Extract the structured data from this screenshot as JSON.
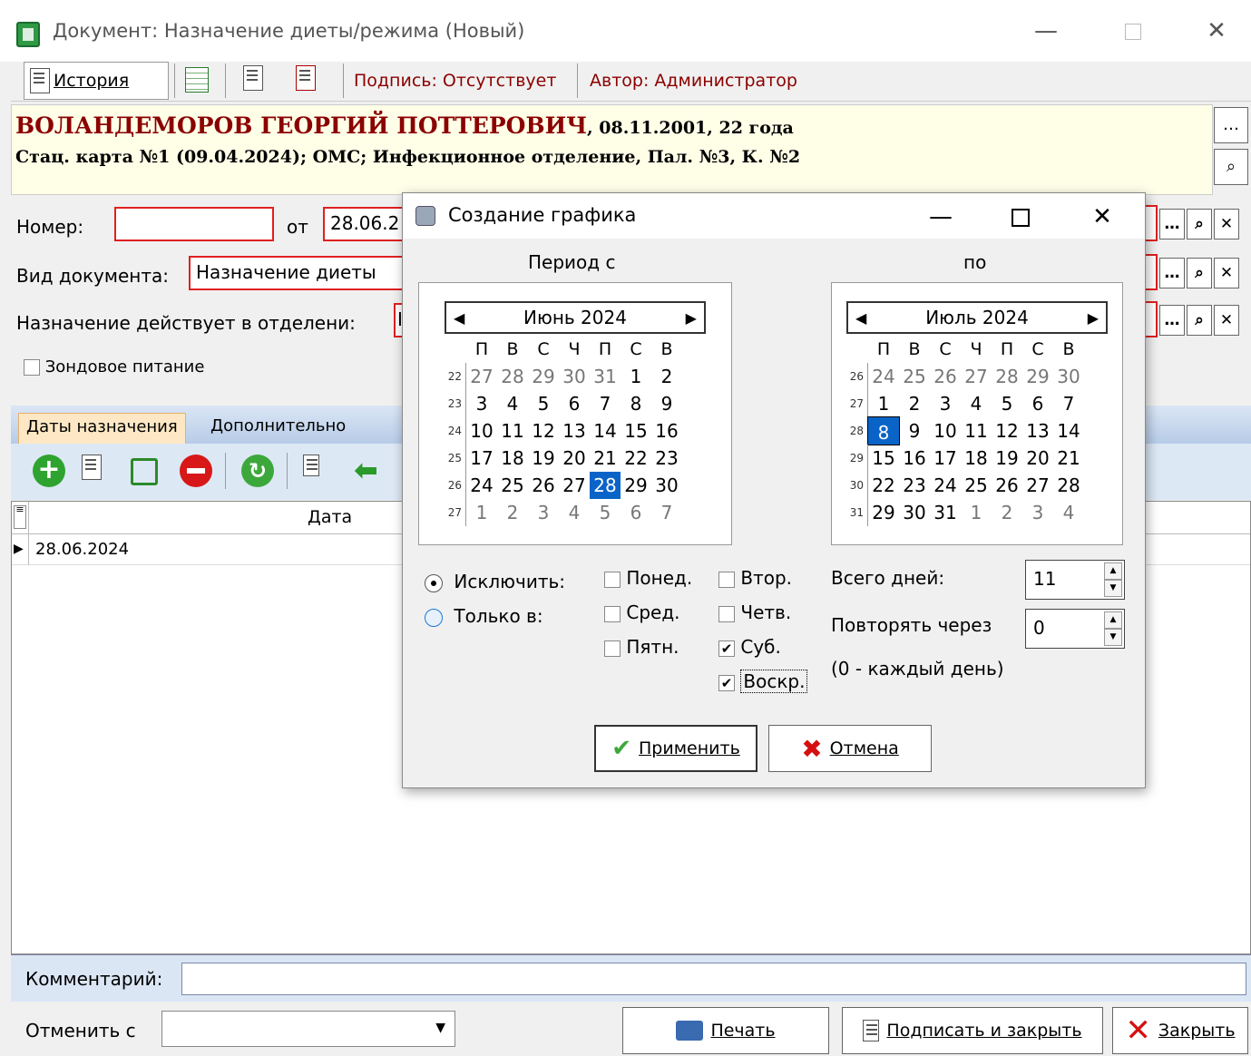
{
  "window": {
    "title": "Документ: Назначение диеты/режима (Новый)"
  },
  "toolbar": {
    "history_label": "История",
    "signature_text": "Подпись: Отсутствует",
    "author_text": "Автор: Администратор"
  },
  "patient": {
    "name": "ВОЛАНДЕМОРОВ ГЕОРГИЙ ПОТТЕРОВИЧ",
    "details": ", 08.11.2001, 22 года",
    "card": "Стац. карта №1 (09.04.2024); ОМС; Инфекционное отделение, Пал. №3, К. №2"
  },
  "form": {
    "number_label": "Номер:",
    "number_value": "",
    "from_label": "от",
    "date_value": "28.06.2",
    "doc_type_label": "Вид документа:",
    "doc_type_value": "Назначение диеты",
    "dept_label": "Назначение действует в отделени:",
    "dept_value": "I",
    "probe_label": "Зондовое питание"
  },
  "tabs": [
    {
      "label": "Даты назначения",
      "active": true
    },
    {
      "label": "Дополнительно",
      "active": false
    }
  ],
  "grid": {
    "column": "Дата",
    "rows": [
      "28.06.2024"
    ]
  },
  "comment": {
    "label": "Комментарий:",
    "value": ""
  },
  "bottom": {
    "cancel_from_label": "Отменить с",
    "cancel_from_value": "",
    "print_label": "Печать",
    "sign_close_label": "Подписать и закрыть",
    "close_label": "Закрыть"
  },
  "dialog": {
    "title": "Создание графика",
    "period_from_label": "Период с",
    "period_to_label": "по",
    "dow_headers": [
      "П",
      "В",
      "С",
      "Ч",
      "П",
      "С",
      "В"
    ],
    "cal_from": {
      "month": "Июнь 2024",
      "weeks": [
        {
          "wk": "22",
          "days": [
            "27",
            "28",
            "29",
            "30",
            "31",
            "1",
            "2"
          ],
          "muted": [
            0,
            1,
            2,
            3,
            4
          ]
        },
        {
          "wk": "23",
          "days": [
            "3",
            "4",
            "5",
            "6",
            "7",
            "8",
            "9"
          ],
          "muted": []
        },
        {
          "wk": "24",
          "days": [
            "10",
            "11",
            "12",
            "13",
            "14",
            "15",
            "16"
          ],
          "muted": []
        },
        {
          "wk": "25",
          "days": [
            "17",
            "18",
            "19",
            "20",
            "21",
            "22",
            "23"
          ],
          "muted": []
        },
        {
          "wk": "26",
          "days": [
            "24",
            "25",
            "26",
            "27",
            "28",
            "29",
            "30"
          ],
          "muted": []
        },
        {
          "wk": "27",
          "days": [
            "1",
            "2",
            "3",
            "4",
            "5",
            "6",
            "7"
          ],
          "muted": [
            0,
            1,
            2,
            3,
            4,
            5,
            6
          ]
        }
      ],
      "selected": "28"
    },
    "cal_to": {
      "month": "Июль 2024",
      "weeks": [
        {
          "wk": "26",
          "days": [
            "24",
            "25",
            "26",
            "27",
            "28",
            "29",
            "30"
          ],
          "muted": [
            0,
            1,
            2,
            3,
            4,
            5,
            6
          ]
        },
        {
          "wk": "27",
          "days": [
            "1",
            "2",
            "3",
            "4",
            "5",
            "6",
            "7"
          ],
          "muted": []
        },
        {
          "wk": "28",
          "days": [
            "8",
            "9",
            "10",
            "11",
            "12",
            "13",
            "14"
          ],
          "muted": []
        },
        {
          "wk": "29",
          "days": [
            "15",
            "16",
            "17",
            "18",
            "19",
            "20",
            "21"
          ],
          "muted": []
        },
        {
          "wk": "30",
          "days": [
            "22",
            "23",
            "24",
            "25",
            "26",
            "27",
            "28"
          ],
          "muted": []
        },
        {
          "wk": "31",
          "days": [
            "29",
            "30",
            "31",
            "1",
            "2",
            "3",
            "4"
          ],
          "muted": [
            3,
            4,
            5,
            6
          ]
        }
      ],
      "selected": "8"
    },
    "exclude_label": "Исключить:",
    "only_label": "Только в:",
    "days": {
      "mon": "Понед.",
      "tue": "Втор.",
      "wed": "Сред.",
      "thu": "Четв.",
      "fri": "Пятн.",
      "sat": "Суб.",
      "sun": "Воскр."
    },
    "total_days_label": "Всего дней:",
    "total_days_value": "11",
    "repeat_label": "Повторять через",
    "repeat_value": "0",
    "repeat_hint": "(0 - каждый день)",
    "apply_label": "Применить",
    "cancel_label": "Отмена"
  }
}
